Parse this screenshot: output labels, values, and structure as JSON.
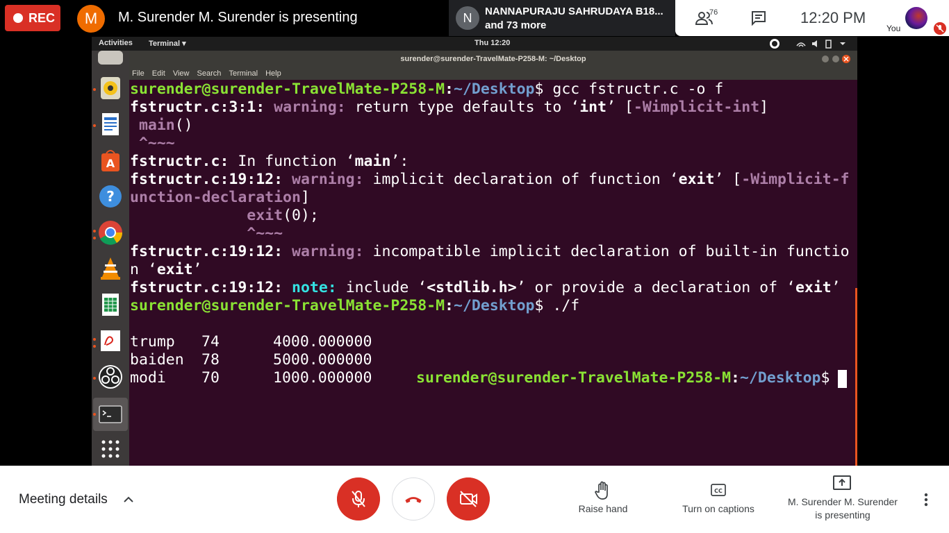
{
  "meet": {
    "rec_label": "REC",
    "presenter_initial": "M",
    "presenter_text": "M. Surender M. Surender is presenting",
    "participant_initial": "N",
    "participant_name": "NANNAPURAJU SAHRUDAYA B18...",
    "participant_more": "and 73 more",
    "people_count": "76",
    "clock": "12:20 PM",
    "you_label": "You",
    "meeting_details": "Meeting details",
    "raise_hand": "Raise hand",
    "captions": "Turn on captions",
    "presenting_line1": "M. Surender M. Surender",
    "presenting_line2": "is presenting",
    "colors": {
      "record_red": "#d93025",
      "avatar_orange": "#ef6c00"
    }
  },
  "ubuntu": {
    "activities": "Activities",
    "terminal_menu": "Terminal ▾",
    "clock": "Thu 12:20",
    "window_title": "surender@surender-TravelMate-P258-M: ~/Desktop",
    "menus": [
      "File",
      "Edit",
      "View",
      "Search",
      "Terminal",
      "Help"
    ],
    "dock_icons": [
      "files-icon",
      "rhythmbox-icon",
      "writer-icon",
      "software-icon",
      "help-icon",
      "chrome-icon",
      "vlc-icon",
      "calc-icon",
      "document-viewer-icon",
      "obs-icon",
      "terminal-icon",
      "app-grid-icon"
    ]
  },
  "terminal": {
    "prompt_user": "surender@surender-TravelMate-P258-M",
    "prompt_colon": ":",
    "prompt_path": "~/Desktop",
    "prompt_dollar": "$",
    "cmd1": " gcc fstructr.c -o f",
    "l2_loc": "fstructr.c:3:1:",
    "l2_warn": "warning:",
    "l2_text1": " return type defaults to ‘",
    "l2_int": "int",
    "l2_text2": "’ [",
    "l2_flag": "-Wimplicit-int",
    "l2_text3": "]",
    "l3_code": " main",
    "l3_paren": "()",
    "l4_caret": " ^~~~",
    "l5_loc": "fstructr.c:",
    "l5_text1": " In function ‘",
    "l5_main": "main",
    "l5_text2": "’:",
    "l6_loc": "fstructr.c:19:12:",
    "l6_warn": "warning:",
    "l6_text1": " implicit declaration of function ‘",
    "l6_exit": "exit",
    "l6_text2": "’ [",
    "l6_flag1": "-Wimplicit-f",
    "l7_flag2": "unction-declaration",
    "l7_text": "]",
    "l8_indent": "             ",
    "l8_code": "exit",
    "l8_args": "(0);",
    "l9_caret": "             ^~~~",
    "l10_loc": "fstructr.c:19:12:",
    "l10_warn": "warning:",
    "l10_text": " incompatible implicit declaration of built-in functio",
    "l11_text1": "n ‘",
    "l11_exit": "exit",
    "l11_text2": "’",
    "l12_loc": "fstructr.c:19:12:",
    "l12_note": "note:",
    "l12_text1": " include ‘",
    "l12_hdr": "<stdlib.h>",
    "l12_text2": "’ or provide a declaration of ‘",
    "l12_exit": "exit",
    "l12_text3": "’",
    "cmd2": " ./f",
    "rows": [
      {
        "name": "trump",
        "age": "74",
        "salary": "4000.000000"
      },
      {
        "name": "baiden",
        "age": "78",
        "salary": "5000.000000"
      },
      {
        "name": "modi",
        "age": "70",
        "salary": "1000.000000"
      }
    ]
  }
}
